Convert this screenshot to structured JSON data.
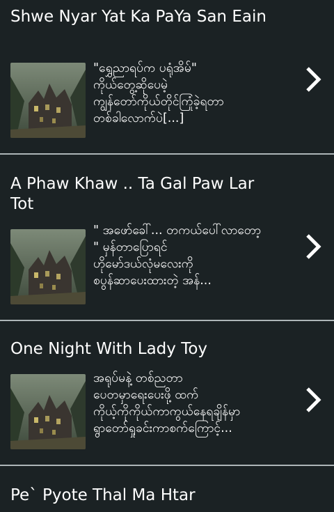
{
  "colors": {
    "background": "#1b2224",
    "divider": "#aeb6b8",
    "text": "#ffffff"
  },
  "items": [
    {
      "title": "Shwe Nyar Yat Ka PaYa San Eain",
      "snippet": "\"ရွှေညာရပ်က ပရုံအိမ်\"\nကိုယ်တွေ့ဆိုပေမဲ့\nကျွန်တော်ကိုယ်တိုင်ကြုံခဲ့ရတာ\nတစ်ခါလောက်ပဲ[...]",
      "thumbnail_icon": "haunted-house-thumbnail",
      "chevron_icon": "chevron-right-icon"
    },
    {
      "title": "A Phaw Khaw .. Ta Gal Paw Lar Tot",
      "snippet": "\" အဖော်ခေါ်... တကယ်ပေါ်လာတော့\n\" မှန်တာပြောရင်\nဟိုမော်ဒယ်လုံမလေးကို\nစပွန်ဆာပေးထားတဲ့ အန်...",
      "thumbnail_icon": "haunted-house-thumbnail",
      "chevron_icon": "chevron-right-icon"
    },
    {
      "title": "One Night With Lady Toy",
      "snippet": "အရုပ်မနဲ့ တစ်ညတာ\n ပေတမှာရေးပေးဖို့ ထက်\nကိုယ့်ကိုကိုယ်ကာကွယ်နေရချိန်မှာ\nရွာတော်ရှုခင်းကာစက်ကြောင့်...",
      "thumbnail_icon": "haunted-house-thumbnail",
      "chevron_icon": "chevron-right-icon"
    },
    {
      "title": "Pe` Pyote Thal Ma Htar"
    }
  ]
}
